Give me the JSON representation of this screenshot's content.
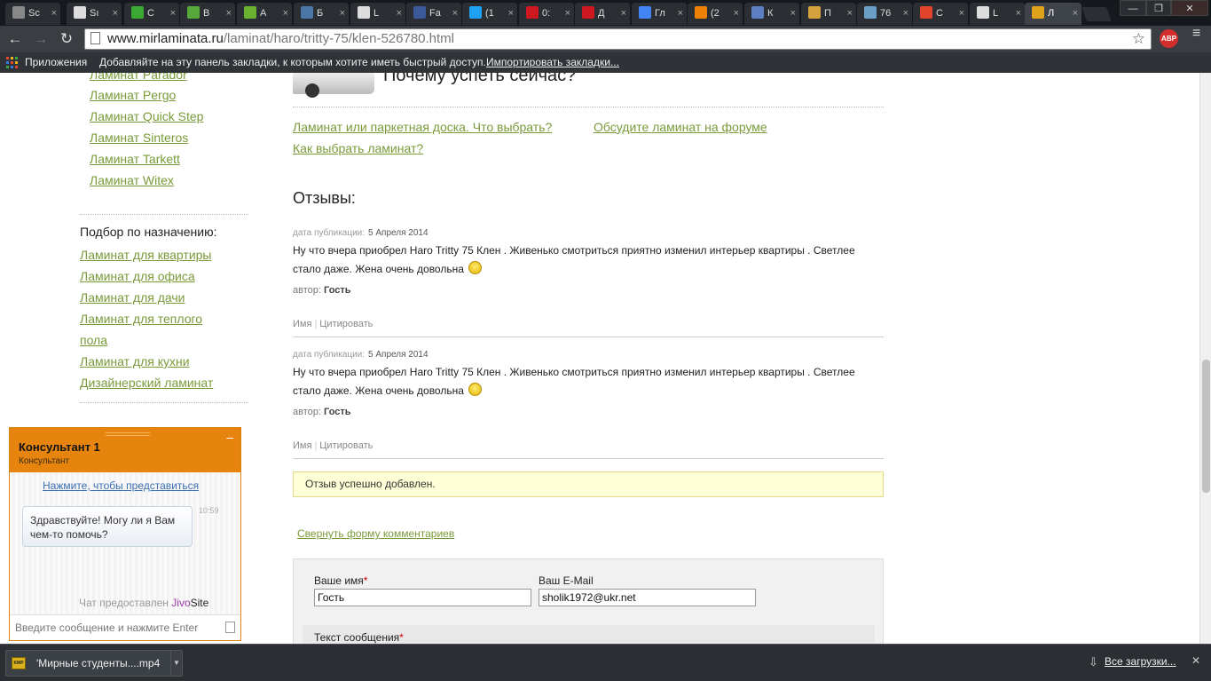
{
  "browser": {
    "tabs": [
      {
        "label": "Sc",
        "icon": "chrome-icon",
        "color": "#888888"
      },
      {
        "label": "Sı",
        "icon": "page-icon",
        "color": "#dddddd"
      },
      {
        "label": "C",
        "icon": "download-arrow-icon",
        "color": "#3aa832"
      },
      {
        "label": "B",
        "icon": "letter-f-green-icon",
        "color": "#57a83a"
      },
      {
        "label": "A",
        "icon": "letter-i-green-icon",
        "color": "#6ab22f"
      },
      {
        "label": "Б",
        "icon": "vk-icon",
        "color": "#4a76a8"
      },
      {
        "label": "L",
        "icon": "page-icon",
        "color": "#dddddd"
      },
      {
        "label": "Fa",
        "icon": "facebook-icon",
        "color": "#3b5998"
      },
      {
        "label": "(1",
        "icon": "twitter-icon",
        "color": "#1da1f2"
      },
      {
        "label": "0:",
        "icon": "youtube-icon",
        "color": "#cc181e"
      },
      {
        "label": "Д",
        "icon": "youtube-icon",
        "color": "#cc181e"
      },
      {
        "label": "Гл",
        "icon": "google-icon",
        "color": "#4285f4"
      },
      {
        "label": "(2",
        "icon": "odnoklassniki-icon",
        "color": "#ee8208"
      },
      {
        "label": "К",
        "icon": "shield-icon",
        "color": "#5b7fc0"
      },
      {
        "label": "П",
        "icon": "image-icon",
        "color": "#d4a23c"
      },
      {
        "label": "76",
        "icon": "image-icon",
        "color": "#6aa0c8"
      },
      {
        "label": "С",
        "icon": "lf-icon",
        "color": "#e2442b"
      },
      {
        "label": "L",
        "icon": "page-icon",
        "color": "#dddddd"
      },
      {
        "label": "Л",
        "icon": "m-logo-icon",
        "color": "#e0a21b"
      }
    ],
    "window_controls": [
      "—",
      "❐",
      "✕"
    ],
    "url_host": "www.mirlaminata.ru",
    "url_path": "/laminat/haro/tritty-75/klen-526780.html",
    "abp_label": "ABP",
    "bookmarks": {
      "apps_label": "Приложения",
      "hint": "Добавляйте на эту панель закладки, к которым хотите иметь быстрый доступ.",
      "import_link": "Импортировать закладки..."
    }
  },
  "sidebar": {
    "brand_links": [
      "Ламинат Parador",
      "Ламинат Pergo",
      "Ламинат Quick Step",
      "Ламинат Sinteros",
      "Ламинат Tarkett",
      "Ламинат Witex"
    ],
    "purpose_heading": "Подбор по назначению:",
    "purpose_links": [
      "Ламинат для квартиры",
      "Ламинат для офиса",
      "Ламинат для дачи",
      "Ламинат для теплого",
      "пола",
      "Ламинат для кухни",
      "Дизайнерский ламинат"
    ]
  },
  "main": {
    "cut_title": "Почему успеть сейчас?",
    "links": {
      "choose_board": "Ламинат или паркетная доска. Что выбрать?",
      "forum": "Обсудите ламинат на форуме",
      "how_choose": "Как выбрать ламинат?"
    },
    "reviews_heading": "Отзывы:",
    "reviews": [
      {
        "date_label": "дата публикации:",
        "date": "5 Апреля 2014",
        "text": "Ну что вчера приобрел Haro Tritty 75 Клен . Живенько смотриться приятно изменил интерьер квартиры . Светлее стало даже. Жена очень довольна",
        "author_label": "автор:",
        "author": "Гость",
        "action_name": "Имя",
        "action_quote": "Цитировать"
      },
      {
        "date_label": "дата публикации:",
        "date": "5 Апреля 2014",
        "text": "Ну что вчера приобрел Haro Tritty 75 Клен . Живенько смотриться приятно изменил интерьер квартиры . Светлее стало даже. Жена очень довольна",
        "author_label": "автор:",
        "author": "Гость",
        "action_name": "Имя",
        "action_quote": "Цитировать"
      }
    ],
    "notice": "Отзыв успешно добавлен.",
    "collapse_link": "Свернуть форму комментариев",
    "form": {
      "name_label": "Ваше имя",
      "name_value": "Гость",
      "email_label": "Ваш E-Mail",
      "email_value": "sholik1972@ukr.net",
      "message_label": "Текст сообщения",
      "required_mark": "*"
    }
  },
  "chat": {
    "operator_name": "Консультант 1",
    "operator_role": "Консультант",
    "minimize": "–",
    "intro_link": "Нажмите, чтобы представиться",
    "message": "Здравствуйте! Могу ли я Вам чем-то помочь?",
    "time": "10:59",
    "powered_prefix": "Чат предоставлен",
    "brand_jivo": "Jivo",
    "brand_site": "Site",
    "input_placeholder": "Введите сообщение и нажмите Enter"
  },
  "downloads": {
    "item_label": "'Мирные студенты....mp4",
    "show_all": "Все загрузки...",
    "close": "✕"
  },
  "colors": {
    "link_green": "#7a9a3a",
    "chat_orange": "#e6840e",
    "notice_yellow": "#ffffd7"
  }
}
